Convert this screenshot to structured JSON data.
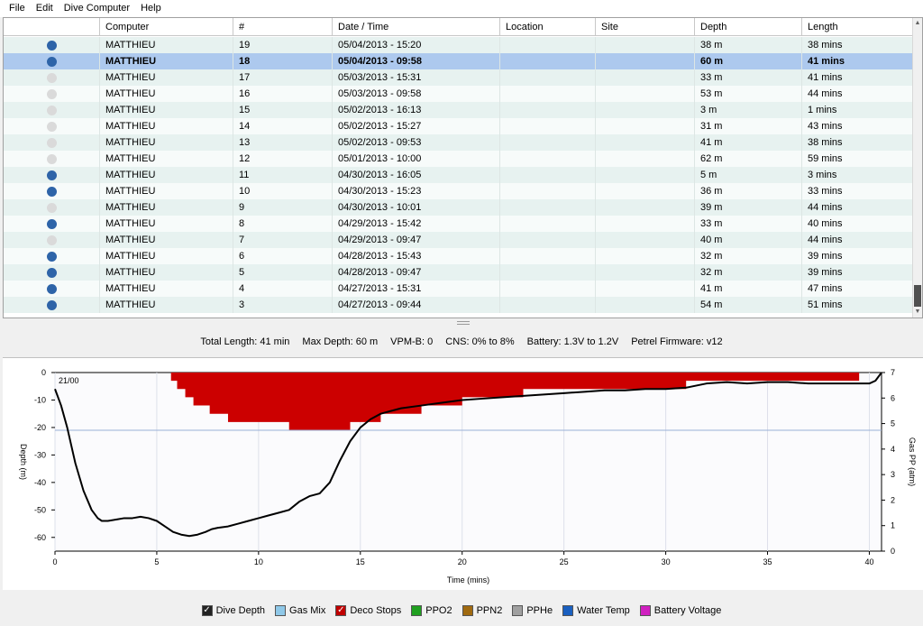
{
  "menu": [
    "File",
    "Edit",
    "Dive Computer",
    "Help"
  ],
  "table": {
    "columns": [
      "",
      "Computer",
      "#",
      "Date / Time",
      "Location",
      "Site",
      "Depth",
      "Length"
    ],
    "rows": [
      {
        "dot": "blue",
        "computer": "MATTHIEU",
        "num": "19",
        "datetime": "05/04/2013 - 15:20",
        "location": "",
        "site": "",
        "depth": "38 m",
        "length": "38 mins"
      },
      {
        "dot": "blue",
        "computer": "MATTHIEU",
        "num": "18",
        "datetime": "05/04/2013 - 09:58",
        "location": "",
        "site": "",
        "depth": "60 m",
        "length": "41 mins",
        "selected": true
      },
      {
        "dot": "gray",
        "computer": "MATTHIEU",
        "num": "17",
        "datetime": "05/03/2013 - 15:31",
        "location": "",
        "site": "",
        "depth": "33 m",
        "length": "41 mins"
      },
      {
        "dot": "gray",
        "computer": "MATTHIEU",
        "num": "16",
        "datetime": "05/03/2013 - 09:58",
        "location": "",
        "site": "",
        "depth": "53 m",
        "length": "44 mins"
      },
      {
        "dot": "gray",
        "computer": "MATTHIEU",
        "num": "15",
        "datetime": "05/02/2013 - 16:13",
        "location": "",
        "site": "",
        "depth": "3 m",
        "length": "1 mins"
      },
      {
        "dot": "gray",
        "computer": "MATTHIEU",
        "num": "14",
        "datetime": "05/02/2013 - 15:27",
        "location": "",
        "site": "",
        "depth": "31 m",
        "length": "43 mins"
      },
      {
        "dot": "gray",
        "computer": "MATTHIEU",
        "num": "13",
        "datetime": "05/02/2013 - 09:53",
        "location": "",
        "site": "",
        "depth": "41 m",
        "length": "38 mins"
      },
      {
        "dot": "gray",
        "computer": "MATTHIEU",
        "num": "12",
        "datetime": "05/01/2013 - 10:00",
        "location": "",
        "site": "",
        "depth": "62 m",
        "length": "59 mins"
      },
      {
        "dot": "blue",
        "computer": "MATTHIEU",
        "num": "11",
        "datetime": "04/30/2013 - 16:05",
        "location": "",
        "site": "",
        "depth": "5 m",
        "length": "3 mins"
      },
      {
        "dot": "blue",
        "computer": "MATTHIEU",
        "num": "10",
        "datetime": "04/30/2013 - 15:23",
        "location": "",
        "site": "",
        "depth": "36 m",
        "length": "33 mins"
      },
      {
        "dot": "gray",
        "computer": "MATTHIEU",
        "num": "9",
        "datetime": "04/30/2013 - 10:01",
        "location": "",
        "site": "",
        "depth": "39 m",
        "length": "44 mins"
      },
      {
        "dot": "blue",
        "computer": "MATTHIEU",
        "num": "8",
        "datetime": "04/29/2013 - 15:42",
        "location": "",
        "site": "",
        "depth": "33 m",
        "length": "40 mins"
      },
      {
        "dot": "gray",
        "computer": "MATTHIEU",
        "num": "7",
        "datetime": "04/29/2013 - 09:47",
        "location": "",
        "site": "",
        "depth": "40 m",
        "length": "44 mins"
      },
      {
        "dot": "blue",
        "computer": "MATTHIEU",
        "num": "6",
        "datetime": "04/28/2013 - 15:43",
        "location": "",
        "site": "",
        "depth": "32 m",
        "length": "39 mins"
      },
      {
        "dot": "blue",
        "computer": "MATTHIEU",
        "num": "5",
        "datetime": "04/28/2013 - 09:47",
        "location": "",
        "site": "",
        "depth": "32 m",
        "length": "39 mins"
      },
      {
        "dot": "blue",
        "computer": "MATTHIEU",
        "num": "4",
        "datetime": "04/27/2013 - 15:31",
        "location": "",
        "site": "",
        "depth": "41 m",
        "length": "47 mins"
      },
      {
        "dot": "blue",
        "computer": "MATTHIEU",
        "num": "3",
        "datetime": "04/27/2013 - 09:44",
        "location": "",
        "site": "",
        "depth": "54 m",
        "length": "51 mins"
      }
    ]
  },
  "colors": {
    "dot_blue": "#2e64a8",
    "dot_gray": "#dadada",
    "deco_red": "#cc0000",
    "depth_line": "#000000",
    "cursor_line": "#9ab0d8"
  },
  "summary": {
    "total_length": "Total Length: 41 min",
    "max_depth": "Max Depth: 60 m",
    "vpm": "VPM-B: 0",
    "cns": "CNS: 0% to 8%",
    "battery": "Battery: 1.3V to 1.2V",
    "firmware": "Petrel Firmware: v12"
  },
  "chart_data": {
    "type": "line",
    "tooltip": "21/00",
    "xlabel": "Time (mins)",
    "ylabel": "Depth (m)",
    "y2label": "Gas PP (atm)",
    "xlim": [
      0,
      40.6
    ],
    "ylim": [
      -65,
      0
    ],
    "y2lim": [
      0,
      7
    ],
    "xticks": [
      0,
      5,
      10,
      15,
      20,
      25,
      30,
      35,
      40
    ],
    "yticks": [
      0,
      -10,
      -20,
      -30,
      -40,
      -50,
      -60
    ],
    "y2ticks": [
      0,
      1,
      2,
      3,
      4,
      5,
      6,
      7
    ],
    "grid": true,
    "cursor_depth": -21,
    "series": [
      {
        "name": "Dive Depth",
        "x": [
          0,
          0.3,
          0.6,
          1.0,
          1.4,
          1.8,
          2.1,
          2.3,
          2.6,
          3.0,
          3.4,
          3.8,
          4.2,
          4.6,
          5.0,
          5.4,
          5.8,
          6.2,
          6.6,
          7.0,
          7.4,
          7.7,
          8.0,
          8.5,
          9.0,
          9.5,
          10.0,
          10.5,
          11.0,
          11.5,
          12.0,
          12.5,
          13.0,
          13.5,
          14.0,
          14.5,
          15.0,
          15.5,
          16.0,
          16.5,
          17.0,
          18.0,
          19.0,
          20.0,
          21.0,
          22.0,
          23.0,
          24.0,
          25.0,
          26.0,
          27.0,
          28.0,
          29.0,
          30.0,
          31.0,
          32.0,
          33.0,
          34.0,
          35.0,
          36.0,
          37.0,
          38.0,
          39.0,
          40.0,
          40.3,
          40.6
        ],
        "values": [
          -6,
          -12,
          -20,
          -33,
          -43,
          -50,
          -53,
          -54,
          -54,
          -53.5,
          -53,
          -53,
          -52.5,
          -53,
          -54,
          -56,
          -58,
          -59,
          -59.5,
          -59,
          -58,
          -57,
          -56.5,
          -56,
          -55,
          -54,
          -53,
          -52,
          -51,
          -50,
          -47,
          -45,
          -44,
          -40,
          -32,
          -25,
          -20,
          -17,
          -15,
          -14,
          -13,
          -12,
          -11,
          -10,
          -9.5,
          -9,
          -8.5,
          -8,
          -7.5,
          -7,
          -6.5,
          -6.5,
          -6,
          -6,
          -5.5,
          -4,
          -3.5,
          -4,
          -3.5,
          -3.5,
          -4,
          -4,
          -4,
          -4,
          -3,
          0
        ]
      },
      {
        "name": "Deco Stops",
        "x": [
          5.7,
          6.0,
          6.4,
          6.8,
          7.2,
          7.6,
          8.0,
          8.5,
          9.0,
          9.5,
          10.0,
          10.5,
          11.0,
          11.5,
          12.0,
          12.5,
          13.0,
          13.5,
          14.0,
          14.5,
          15.0,
          15.5,
          16.0,
          16.5,
          17.0,
          18.0,
          19.0,
          20.0,
          21.0,
          22.0,
          23.0,
          24.0,
          25.0,
          26.0,
          27.0,
          28.0,
          29.0,
          30.0,
          31.0,
          32.0,
          33.0,
          34.0,
          35.0,
          36.0,
          37.0,
          38.0,
          39.0,
          39.5
        ],
        "values": [
          -3,
          -6,
          -9,
          -12,
          -12,
          -15,
          -15,
          -18,
          -18,
          -18,
          -18,
          -18,
          -18,
          -21,
          -21,
          -21,
          -21,
          -21,
          -21,
          -18,
          -18,
          -18,
          -15,
          -15,
          -15,
          -12,
          -12,
          -9,
          -9,
          -9,
          -6,
          -6,
          -6,
          -6,
          -6,
          -6,
          -6,
          -6,
          -3,
          -3,
          -3,
          -3,
          -3,
          -3,
          -3,
          -3,
          -3,
          -3
        ]
      }
    ]
  },
  "legend": [
    {
      "label": "Dive Depth",
      "checked": true,
      "color": "#222222"
    },
    {
      "label": "Gas Mix",
      "checked": false,
      "color": "#8fc8e8"
    },
    {
      "label": "Deco Stops",
      "checked": true,
      "color": "#c00000"
    },
    {
      "label": "PPO2",
      "checked": false,
      "color": "#20a020"
    },
    {
      "label": "PPN2",
      "checked": false,
      "color": "#a06a10"
    },
    {
      "label": "PPHe",
      "checked": false,
      "color": "#a0a0a0"
    },
    {
      "label": "Water Temp",
      "checked": false,
      "color": "#1a60c0"
    },
    {
      "label": "Battery Voltage",
      "checked": false,
      "color": "#d020c0"
    }
  ]
}
